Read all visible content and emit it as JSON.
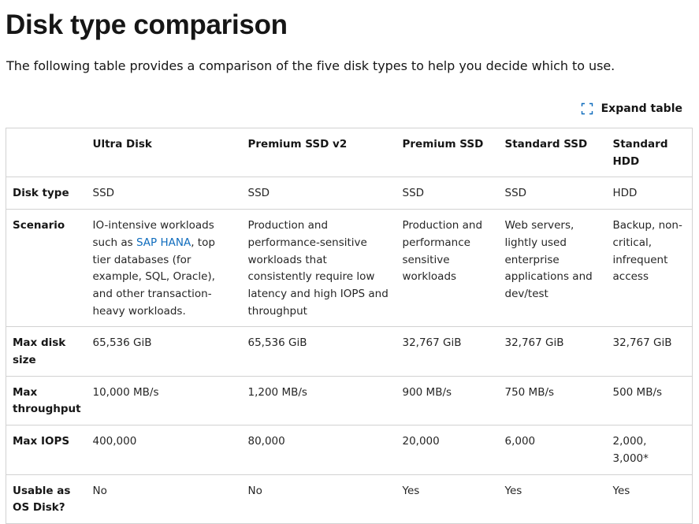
{
  "page": {
    "title": "Disk type comparison",
    "intro": "The following table provides a comparison of the five disk types to help you decide which to use.",
    "expand_label": "Expand table"
  },
  "table": {
    "headers": [
      "",
      "Ultra Disk",
      "Premium SSD v2",
      "Premium SSD",
      "Standard SSD",
      "Standard HDD"
    ],
    "rows": [
      {
        "label": "Disk type",
        "cells": [
          "SSD",
          "SSD",
          "SSD",
          "SSD",
          "HDD"
        ]
      },
      {
        "label": "Scenario",
        "ultra": {
          "before": "IO-intensive workloads such as ",
          "link": "SAP HANA",
          "after": ", top tier databases (for example, SQL, Oracle), and other transaction-heavy workloads."
        },
        "cells": [
          "",
          "Production and performance-sensitive workloads that consistently require low latency and high IOPS and throughput",
          "Production and performance sensitive workloads",
          "Web servers, lightly used enterprise applications and dev/test",
          "Backup, non-critical, infrequent access"
        ]
      },
      {
        "label": "Max disk size",
        "cells": [
          "65,536 GiB",
          "65,536 GiB",
          "32,767 GiB",
          "32,767 GiB",
          "32,767 GiB"
        ]
      },
      {
        "label": "Max throughput",
        "cells": [
          "10,000 MB/s",
          "1,200 MB/s",
          "900 MB/s",
          "750 MB/s",
          "500 MB/s"
        ]
      },
      {
        "label": "Max IOPS",
        "cells": [
          "400,000",
          "80,000",
          "20,000",
          "6,000",
          "2,000, 3,000*"
        ]
      },
      {
        "label": "Usable as OS Disk?",
        "cells": [
          "No",
          "No",
          "Yes",
          "Yes",
          "Yes"
        ]
      }
    ]
  },
  "colors": {
    "link": "#0f6cbd",
    "border": "#d2d2d2",
    "icon": "#0f6cbd"
  },
  "icons": {
    "expand": "expand-corners-icon"
  }
}
